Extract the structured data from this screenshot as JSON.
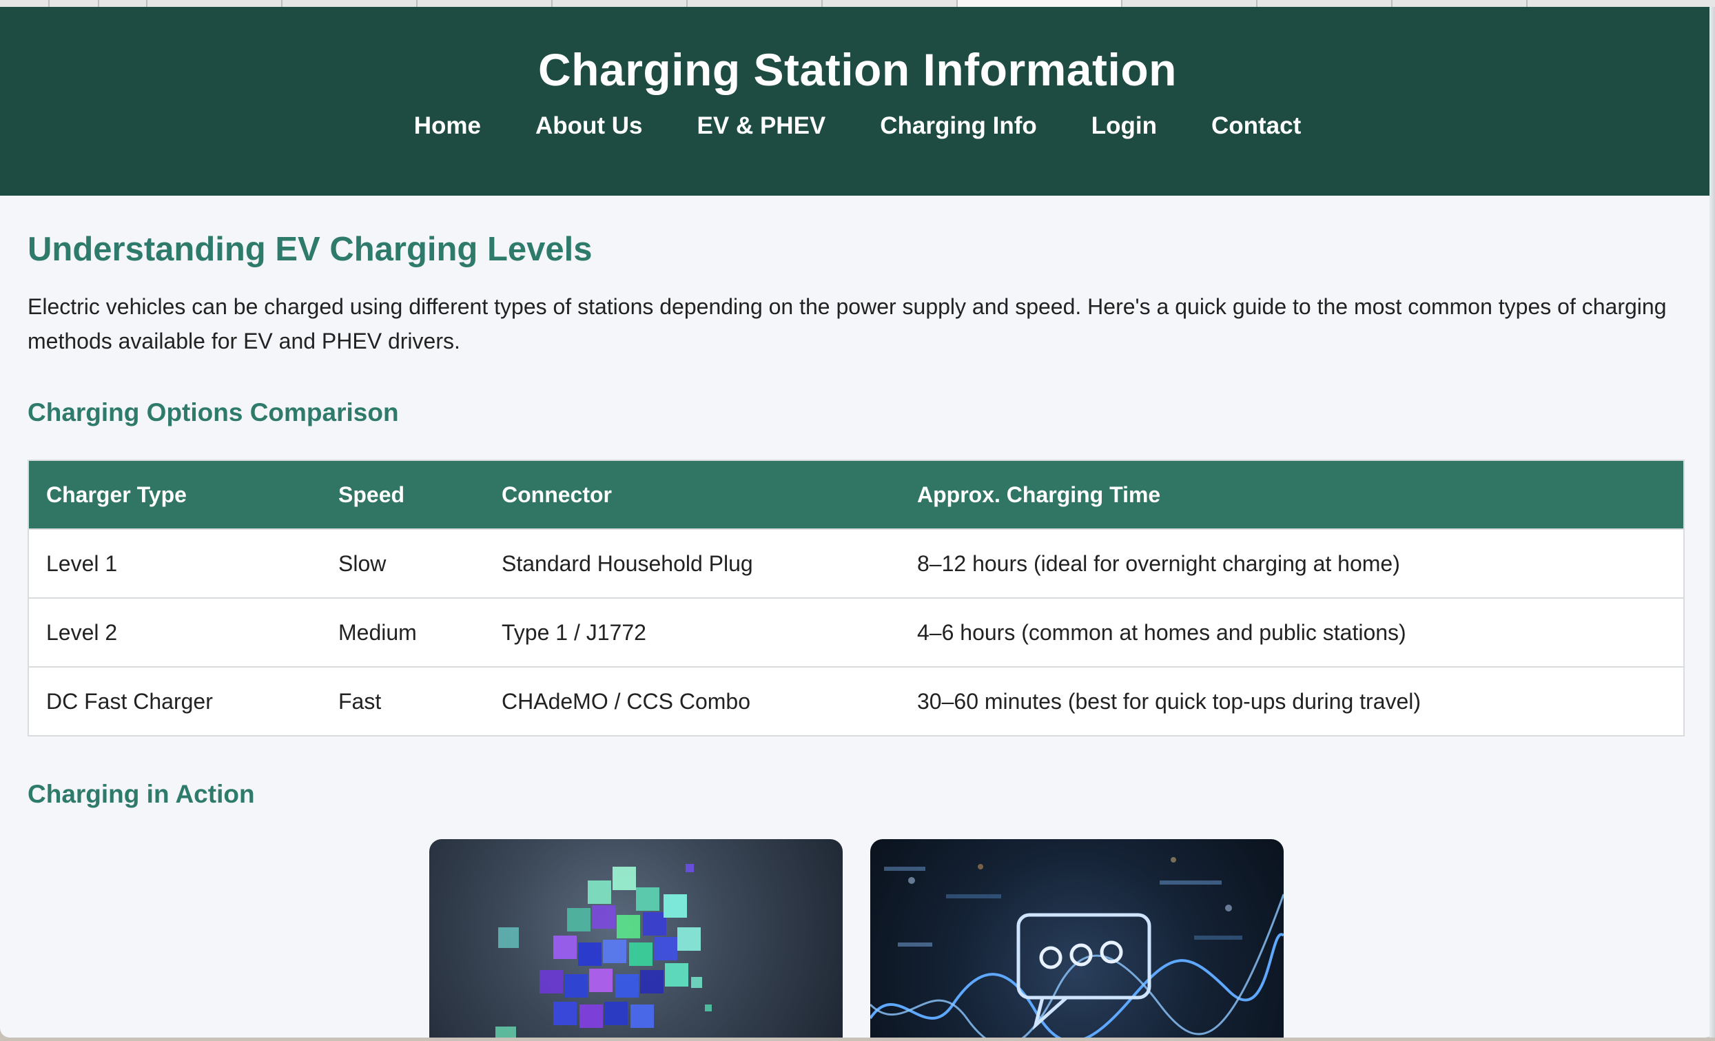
{
  "header": {
    "title": "Charging Station Information",
    "nav": [
      "Home",
      "About Us",
      "EV & PHEV",
      "Charging Info",
      "Login",
      "Contact"
    ]
  },
  "main": {
    "title": "Understanding EV Charging Levels",
    "intro": "Electric vehicles can be charged using different types of stations depending on the power supply and speed. Here's a quick guide to the most common types of charging methods available for EV and PHEV drivers.",
    "comparison_heading": "Charging Options Comparison",
    "table": {
      "headers": [
        "Charger Type",
        "Speed",
        "Connector",
        "Approx. Charging Time"
      ],
      "rows": [
        [
          "Level 1",
          "Slow",
          "Standard Household Plug",
          "8–12 hours (ideal for overnight charging at home)"
        ],
        [
          "Level 2",
          "Medium",
          "Type 1 / J1772",
          "4–6 hours (common at homes and public stations)"
        ],
        [
          "DC Fast Charger",
          "Fast",
          "CHAdeMO / CCS Combo",
          "30–60 minutes (best for quick top-ups during travel)"
        ]
      ]
    },
    "action_heading": "Charging in Action"
  },
  "colors": {
    "header_bg": "#1f4c42",
    "accent": "#2e7a6b",
    "table_header_bg": "#317565",
    "page_bg": "#f4f6f9"
  }
}
